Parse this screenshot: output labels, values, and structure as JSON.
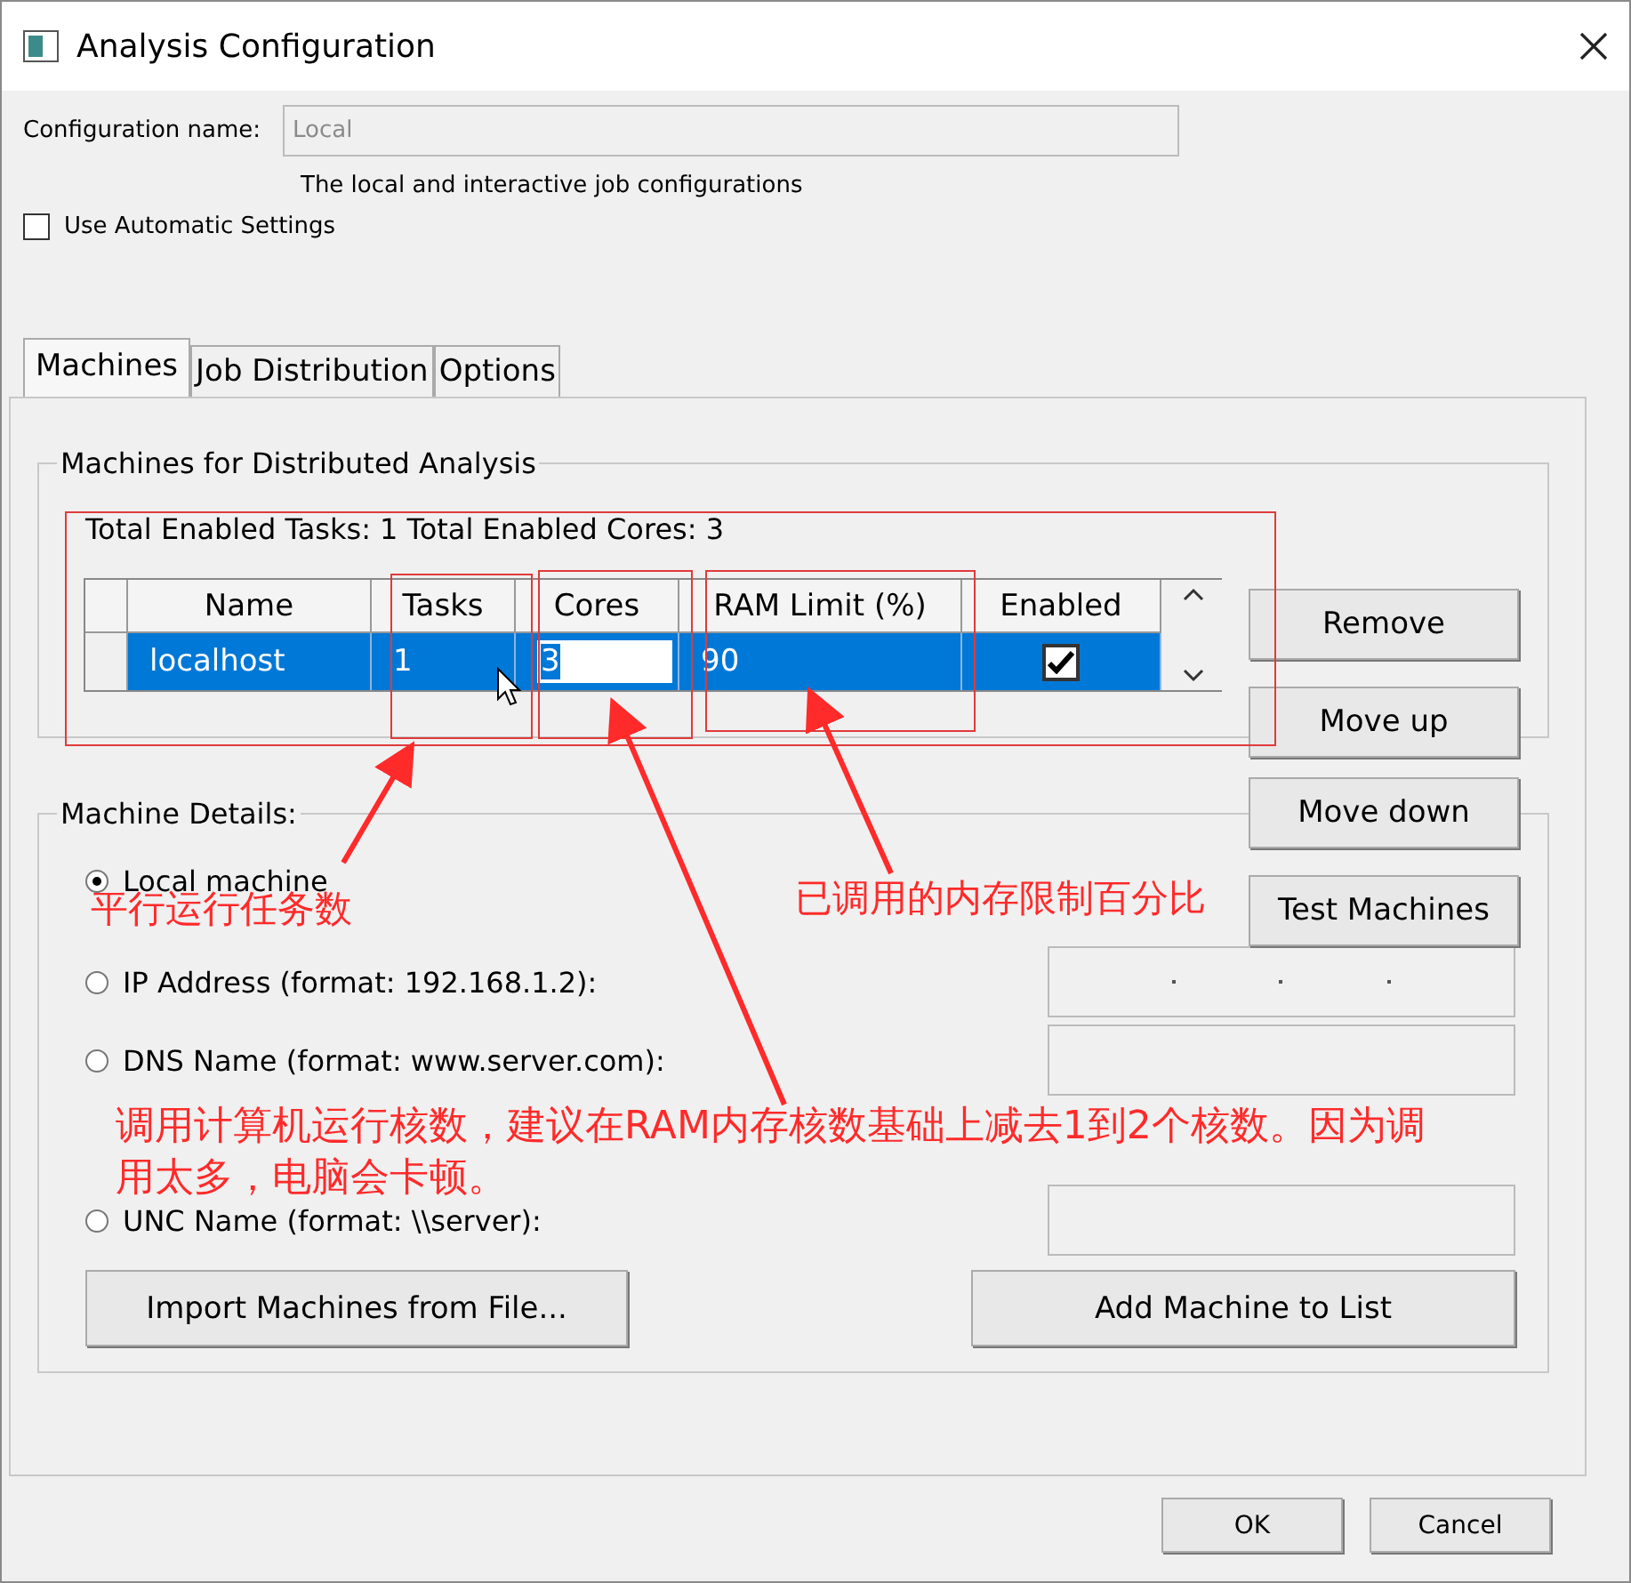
{
  "window": {
    "title": "Analysis Configuration"
  },
  "configuration_name": {
    "label": "Configuration name:",
    "value": "Local",
    "disabled": true
  },
  "description": "The local and interactive job configurations",
  "automatic_settings": {
    "label": "Use Automatic Settings",
    "checked": false
  },
  "tabs": [
    {
      "label": "Machines",
      "selected": true
    },
    {
      "label": "Job Distribution",
      "selected": false
    },
    {
      "label": "Options",
      "selected": false
    }
  ],
  "machines_group": {
    "title": "Machines for Distributed Analysis",
    "summary": "Total Enabled Tasks: 1  Total Enabled Cores: 3",
    "table": {
      "columns": [
        "Name",
        "Tasks",
        "Cores",
        "RAM Limit (%)",
        "Enabled"
      ],
      "rows": [
        {
          "cells": [
            {
              "text": "localhost",
              "editing": false
            },
            {
              "text": "1",
              "editing": false
            },
            {
              "text": "3",
              "editing": true
            },
            {
              "text": "90",
              "editing": false
            }
          ],
          "enabled": true,
          "selected": true
        }
      ]
    }
  },
  "side_buttons": [
    "Remove",
    "Move up",
    "Move down",
    "Test Machines"
  ],
  "details_group": {
    "title": "Machine Details:",
    "options": [
      {
        "label": "Local machine",
        "selected": true,
        "kind": "none"
      },
      {
        "label": "IP Address (format: 192.168.1.2):",
        "selected": false,
        "kind": "ip"
      },
      {
        "label": "DNS Name (format: www.server.com):",
        "selected": false,
        "kind": "text"
      },
      {
        "label": "UNC Name (format: \\\\server):",
        "selected": false,
        "kind": "text"
      }
    ],
    "buttons": [
      "Import Machines from File...",
      "Add Machine to List"
    ]
  },
  "footer_buttons": [
    "OK",
    "Cancel"
  ],
  "annotations": [
    "平行运行任务数",
    "已调用的内存限制百分比",
    "调用计算机运行核数，建议在RAM内存核数基础上减去1到2个核数。因为调用太多，电脑会卡顿。"
  ]
}
